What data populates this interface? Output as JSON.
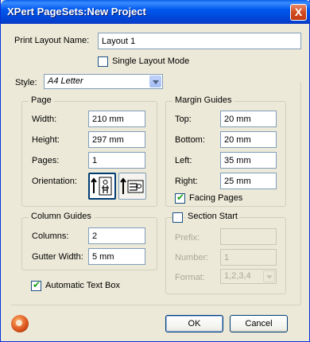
{
  "window": {
    "title": "XPert PageSets:New Project",
    "close_glyph": "X"
  },
  "layout_name": {
    "label": "Print Layout Name:",
    "value": "Layout 1"
  },
  "single_layout": {
    "label": "Single Layout Mode",
    "checked": false
  },
  "style": {
    "label": "Style:",
    "value": "A4 Letter"
  },
  "page": {
    "title": "Page",
    "width_label": "Width:",
    "width_value": "210 mm",
    "height_label": "Height:",
    "height_value": "297 mm",
    "pages_label": "Pages:",
    "pages_value": "1",
    "orientation_label": "Orientation:",
    "orientation_selected": "portrait"
  },
  "margins": {
    "title": "Margin Guides",
    "top_label": "Top:",
    "top_value": "20 mm",
    "bottom_label": "Bottom:",
    "bottom_value": "20 mm",
    "left_label": "Left:",
    "left_value": "35 mm",
    "right_label": "Right:",
    "right_value": "25 mm",
    "facing_label": "Facing Pages",
    "facing_checked": true
  },
  "columns": {
    "title": "Column Guides",
    "columns_label": "Columns:",
    "columns_value": "2",
    "gutter_label": "Gutter Width:",
    "gutter_value": "5 mm"
  },
  "section": {
    "title": "Section Start",
    "checked": false,
    "prefix_label": "Prefix:",
    "prefix_value": "",
    "number_label": "Number:",
    "number_value": "1",
    "format_label": "Format:",
    "format_value": "1,2,3,4"
  },
  "auto_text": {
    "label": "Automatic Text Box",
    "checked": true
  },
  "buttons": {
    "ok": "OK",
    "cancel": "Cancel"
  },
  "colors": {
    "titlebar": "#0058ee",
    "dialog_bg": "#ece9d8",
    "check_tick": "#21a121",
    "close": "#d24b1f"
  }
}
